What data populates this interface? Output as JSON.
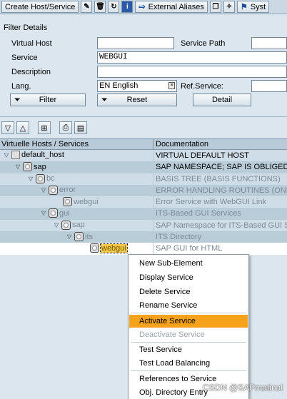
{
  "toolbar": {
    "create_host_service": "Create Host/Service",
    "external_aliases": "External Aliases",
    "system_label": "Syst"
  },
  "filter": {
    "title": "Filter Details",
    "virtual_host_label": "Virtual Host",
    "virtual_host_value": "",
    "service_path_label": "Service Path",
    "service_path_value": "",
    "service_label": "Service",
    "service_value": "WEBGUI",
    "description_label": "Description",
    "description_value": "",
    "lang_label": "Lang.",
    "lang_value": "EN English",
    "ref_service_label": "Ref.Service:",
    "ref_service_value": "",
    "filter_button": "Filter",
    "reset_button": "Reset",
    "detail_button": "Detail"
  },
  "tree": {
    "col_hosts": "Virtuelle Hosts / Services",
    "col_doc": "Documentation",
    "rows": [
      {
        "name": "default_host",
        "doc": "VIRTUAL DEFAULT HOST"
      },
      {
        "name": "sap",
        "doc": "SAP NAMESPACE; SAP IS OBLIGED N"
      },
      {
        "name": "bc",
        "doc": "BASIS TREE (BASIS FUNCTIONS)"
      },
      {
        "name": "error",
        "doc": "ERROR HANDLING ROUTINES (ONLY"
      },
      {
        "name": "webgui",
        "doc": "Error Service with WebGUI Link"
      },
      {
        "name": "gui",
        "doc": "ITS-Based GUI Services"
      },
      {
        "name": "sap",
        "doc": "SAP Namespace for ITS-Based GUI Se"
      },
      {
        "name": "its",
        "doc": "ITS Directory"
      },
      {
        "name": "webgui",
        "doc": "SAP GUI for HTML"
      }
    ]
  },
  "context_menu": {
    "items": [
      {
        "label": "New Sub-Element"
      },
      {
        "label": "Display Service"
      },
      {
        "label": "Delete Service"
      },
      {
        "label": "Rename Service"
      },
      {
        "label": "Activate Service"
      },
      {
        "label": "Deactivate Service"
      },
      {
        "label": "Test Service"
      },
      {
        "label": "Test Load Balancing"
      },
      {
        "label": "References to Service"
      },
      {
        "label": "Obj. Directory Entry"
      }
    ]
  },
  "watermark": "CSDN @SAPmatinal",
  "colors": {
    "highlight": "#f7a21b",
    "background": "#dbe6ee"
  }
}
